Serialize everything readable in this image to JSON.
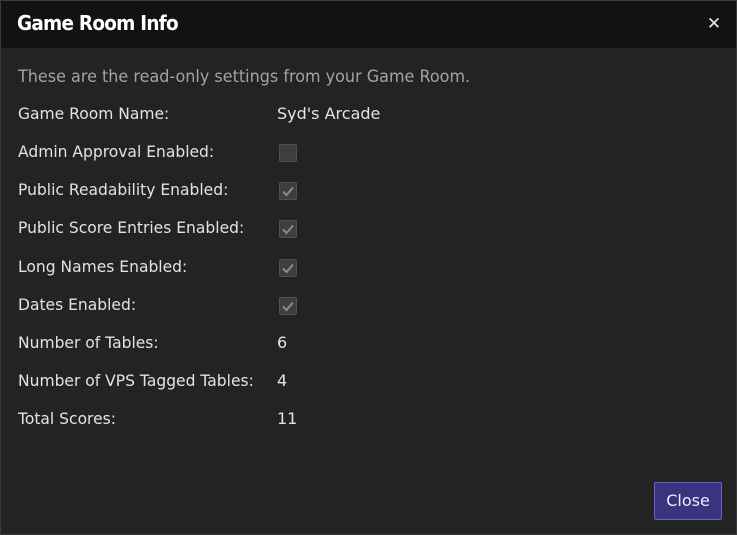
{
  "dialog": {
    "title": "Game Room Info",
    "close_icon": "close-icon",
    "intro": "These are the read-only settings from your Game Room."
  },
  "fields": {
    "name": {
      "label": "Game Room Name:",
      "value": "Syd's Arcade"
    },
    "admin_approval": {
      "label": "Admin Approval Enabled:",
      "checked": false
    },
    "public_readability": {
      "label": "Public Readability Enabled:",
      "checked": true
    },
    "public_score_entries": {
      "label": "Public Score Entries Enabled:",
      "checked": true
    },
    "long_names": {
      "label": "Long Names Enabled:",
      "checked": true
    },
    "dates": {
      "label": "Dates Enabled:",
      "checked": true
    },
    "tables": {
      "label": "Number of Tables:",
      "value": "6"
    },
    "vps_tables": {
      "label": "Number of VPS Tagged Tables:",
      "value": "4"
    },
    "total_scores": {
      "label": "Total Scores:",
      "value": "11"
    }
  },
  "footer": {
    "close_label": "Close"
  },
  "colors": {
    "background": "#232323",
    "titlebar": "#121212",
    "accent": "#3a3480",
    "accent_border": "#6a63c7"
  }
}
